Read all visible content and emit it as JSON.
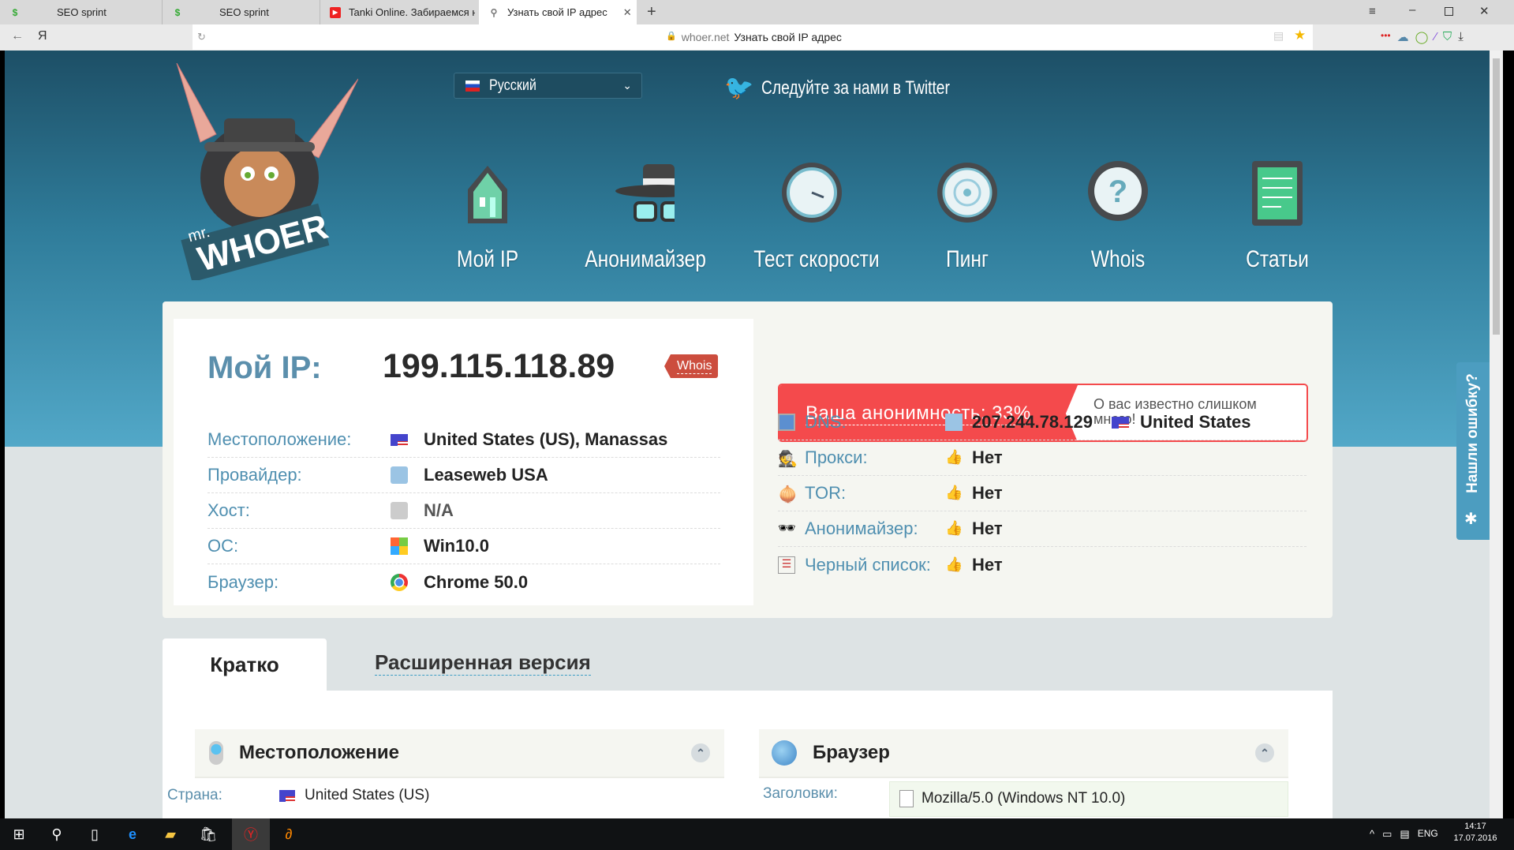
{
  "browser": {
    "tabs": [
      {
        "label": "SEO sprint",
        "icon": "seo-sprint-icon"
      },
      {
        "label": "SEO sprint",
        "icon": "seo-sprint-icon"
      },
      {
        "label": "Tanki Online. Забираемся н",
        "icon": "youtube-icon"
      },
      {
        "label": "Узнать свой IP адрес",
        "icon": "search-icon"
      }
    ],
    "new_tab": "+",
    "yandex": "Я",
    "url_domain": "whoer.net",
    "url_title": "Узнать свой IP адрес"
  },
  "header": {
    "logo_text": "mr. WHOER",
    "language": "Русский",
    "twitter": "Следуйте за нами в Twitter",
    "nav": [
      {
        "label": "Мой IP"
      },
      {
        "label": "Анонимайзер"
      },
      {
        "label": "Тест скорости"
      },
      {
        "label": "Пинг"
      },
      {
        "label": "Whois"
      },
      {
        "label": "Статьи"
      }
    ]
  },
  "ipinfo": {
    "title": "Мой IP:",
    "ip": "199.115.118.89",
    "whois": "Whois",
    "rows": [
      {
        "label": "Местоположение:",
        "value": "United States (US), Manassas"
      },
      {
        "label": "Провайдер:",
        "value": "Leaseweb USA"
      },
      {
        "label": "Хост:",
        "value": "N/A"
      },
      {
        "label": "ОС:",
        "value": "Win10.0"
      },
      {
        "label": "Браузер:",
        "value": "Chrome 50.0"
      }
    ]
  },
  "anonymity": {
    "label": "Ваша анонимность: 33%",
    "percent": 33,
    "message": "О вас известно слишком много!",
    "color": "#f44a4c",
    "rows": [
      {
        "label": "DNS:",
        "value": "207.244.78.129",
        "country": "United States"
      },
      {
        "label": "Прокси:",
        "value": "Нет"
      },
      {
        "label": "TOR:",
        "value": "Нет"
      },
      {
        "label": "Анонимайзер:",
        "value": "Нет"
      },
      {
        "label": "Черный список:",
        "value": "Нет"
      }
    ]
  },
  "tabs": {
    "short": "Кратко",
    "extended": "Расширенная версия"
  },
  "sections": {
    "location": {
      "title": "Местоположение",
      "country_label": "Страна:",
      "country_value": "United States (US)"
    },
    "browser": {
      "title": "Браузер",
      "headers_label": "Заголовки:",
      "headers_value": "Mozilla/5.0 (Windows NT 10.0)"
    }
  },
  "feedback": "Нашли ошибку?",
  "taskbar": {
    "lang": "ENG",
    "time": "14:17",
    "date": "17.07.2016"
  }
}
